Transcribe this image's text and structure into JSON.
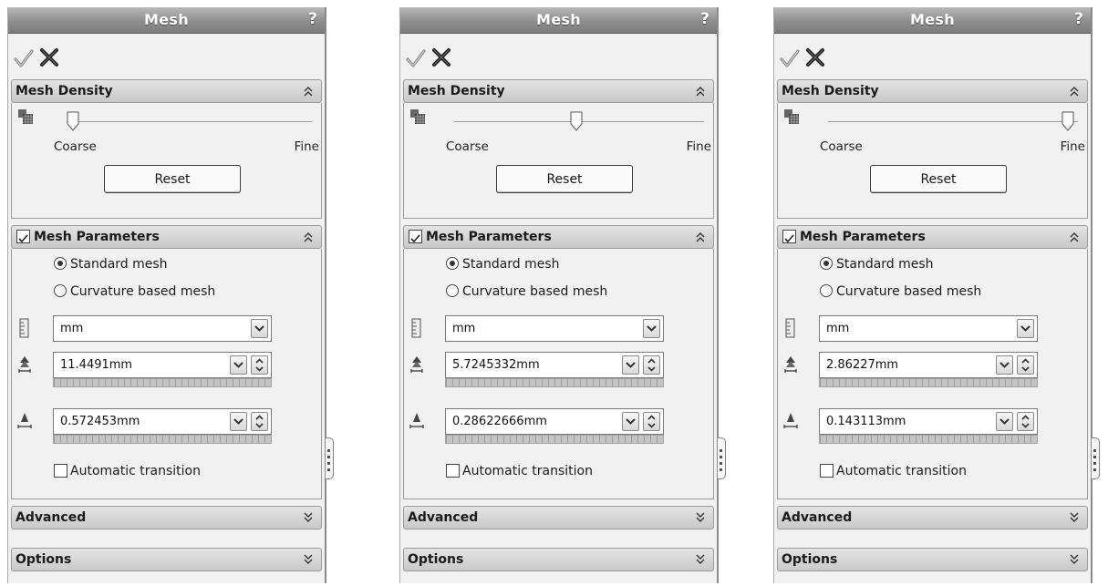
{
  "panels": [
    {
      "title": "Mesh",
      "help": "?",
      "density": {
        "header": "Mesh Density",
        "coarse": "Coarse",
        "fine": "Fine",
        "slider_level": 0.0,
        "reset": "Reset"
      },
      "params": {
        "header": "Mesh Parameters",
        "checked": true,
        "standard": "Standard mesh",
        "curvature": "Curvature based mesh",
        "selected": "standard",
        "unit": "mm",
        "element_size": "11.4491mm",
        "tolerance": "0.572453mm",
        "auto_transition": "Automatic transition"
      },
      "advanced": "Advanced",
      "options": "Options"
    },
    {
      "title": "Mesh",
      "help": "?",
      "density": {
        "header": "Mesh Density",
        "coarse": "Coarse",
        "fine": "Fine",
        "slider_level": 0.5,
        "reset": "Reset"
      },
      "params": {
        "header": "Mesh Parameters",
        "checked": true,
        "standard": "Standard mesh",
        "curvature": "Curvature based mesh",
        "selected": "standard",
        "unit": "mm",
        "element_size": "5.7245332mm",
        "tolerance": "0.28622666mm",
        "auto_transition": "Automatic transition"
      },
      "advanced": "Advanced",
      "options": "Options"
    },
    {
      "title": "Mesh",
      "help": "?",
      "density": {
        "header": "Mesh Density",
        "coarse": "Coarse",
        "fine": "Fine",
        "slider_level": 1.0,
        "reset": "Reset"
      },
      "params": {
        "header": "Mesh Parameters",
        "checked": true,
        "standard": "Standard mesh",
        "curvature": "Curvature based mesh",
        "selected": "standard",
        "unit": "mm",
        "element_size": "2.86227mm",
        "tolerance": "0.143113mm",
        "auto_transition": "Automatic transition"
      },
      "advanced": "Advanced",
      "options": "Options"
    }
  ],
  "icons": {
    "ok": "checkmark-icon",
    "cancel": "close-x-icon",
    "collapse": "double-chevron-up-icon",
    "expand": "double-chevron-down-icon",
    "density": "mesh-density-icon",
    "unit": "unit-ruler-icon",
    "element_size": "element-size-icon",
    "tolerance": "tolerance-icon"
  },
  "colors": {
    "title_bar": "#8e8e8e",
    "panel_bg": "#f1f1f1",
    "header_bg": "#d6d6d6"
  }
}
